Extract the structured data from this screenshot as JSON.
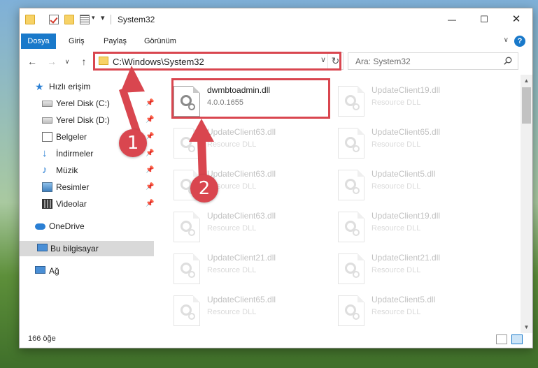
{
  "window": {
    "title": "System32",
    "minimize_glyph": "—",
    "maximize_glyph": "☐",
    "close_glyph": "✕",
    "help_glyph": "?"
  },
  "ribbon": {
    "tabs": [
      "Dosya",
      "Giriş",
      "Paylaş",
      "Görünüm"
    ]
  },
  "navigation": {
    "back_glyph": "←",
    "forward_glyph": "→",
    "recent_glyph": "∨",
    "up_glyph": "↑",
    "address": "C:\\Windows\\System32",
    "refresh_glyph": "↻",
    "search_placeholder": "Ara: System32"
  },
  "nav_pane": {
    "quick_access": "Hızlı erişim",
    "items": [
      {
        "label": "Yerel Disk (C:)",
        "icon": "drive-icon"
      },
      {
        "label": "Yerel Disk (D:)",
        "icon": "drive-icon"
      },
      {
        "label": "Belgeler",
        "icon": "documents-icon"
      },
      {
        "label": "İndirmeler",
        "icon": "downloads-icon"
      },
      {
        "label": "Müzik",
        "icon": "music-icon"
      },
      {
        "label": "Resimler",
        "icon": "pictures-icon"
      },
      {
        "label": "Videolar",
        "icon": "videos-icon"
      }
    ],
    "onedrive": "OneDrive",
    "this_pc": "Bu bilgisayar",
    "network": "Ağ"
  },
  "files": [
    {
      "name": "dwmbtoadmin.dll",
      "sub": "4.0.0.1655",
      "highlighted": true
    },
    {
      "name": "UpdateClient19.dll",
      "sub": "Resource DLL"
    },
    {
      "name": "UpdateClient63.dll",
      "sub": "Resource DLL"
    },
    {
      "name": "UpdateClient65.dll",
      "sub": "Resource DLL"
    },
    {
      "name": "UpdateClient63.dll",
      "sub": "Resource DLL"
    },
    {
      "name": "UpdateClient5.dll",
      "sub": "Resource DLL"
    },
    {
      "name": "UpdateClient63.dll",
      "sub": "Resource DLL"
    },
    {
      "name": "UpdateClient19.dll",
      "sub": "Resource DLL"
    },
    {
      "name": "UpdateClient21.dll",
      "sub": "Resource DLL"
    },
    {
      "name": "UpdateClient21.dll",
      "sub": "Resource DLL"
    },
    {
      "name": "UpdateClient65.dll",
      "sub": "Resource DLL"
    },
    {
      "name": "UpdateClient5.dll",
      "sub": "Resource DLL"
    }
  ],
  "status": {
    "item_count": "166 öğe"
  },
  "annotations": {
    "step1": "1",
    "step2": "2",
    "color": "#d9464f"
  },
  "colors": {
    "accent": "#1979ca"
  }
}
